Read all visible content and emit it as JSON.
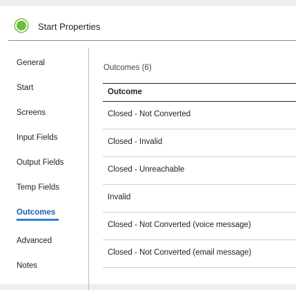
{
  "header": {
    "title": "Start Properties",
    "status_color": "#6abf3a"
  },
  "sidebar": {
    "items": [
      {
        "label": "General"
      },
      {
        "label": "Start"
      },
      {
        "label": "Screens"
      },
      {
        "label": "Input Fields"
      },
      {
        "label": "Output Fields"
      },
      {
        "label": "Temp Fields"
      },
      {
        "label": "Outcomes",
        "active": true
      },
      {
        "label": "Advanced"
      },
      {
        "label": "Notes"
      }
    ],
    "active_color": "#1f5fa8"
  },
  "main": {
    "count_label": "Outcomes (6)",
    "table": {
      "header": "Outcome",
      "rows": [
        "Closed - Not Converted",
        "Closed - Invalid",
        "Closed - Unreachable",
        "Invalid",
        "Closed - Not Converted (voice message)",
        "Closed - Not Converted (email message)"
      ]
    }
  }
}
